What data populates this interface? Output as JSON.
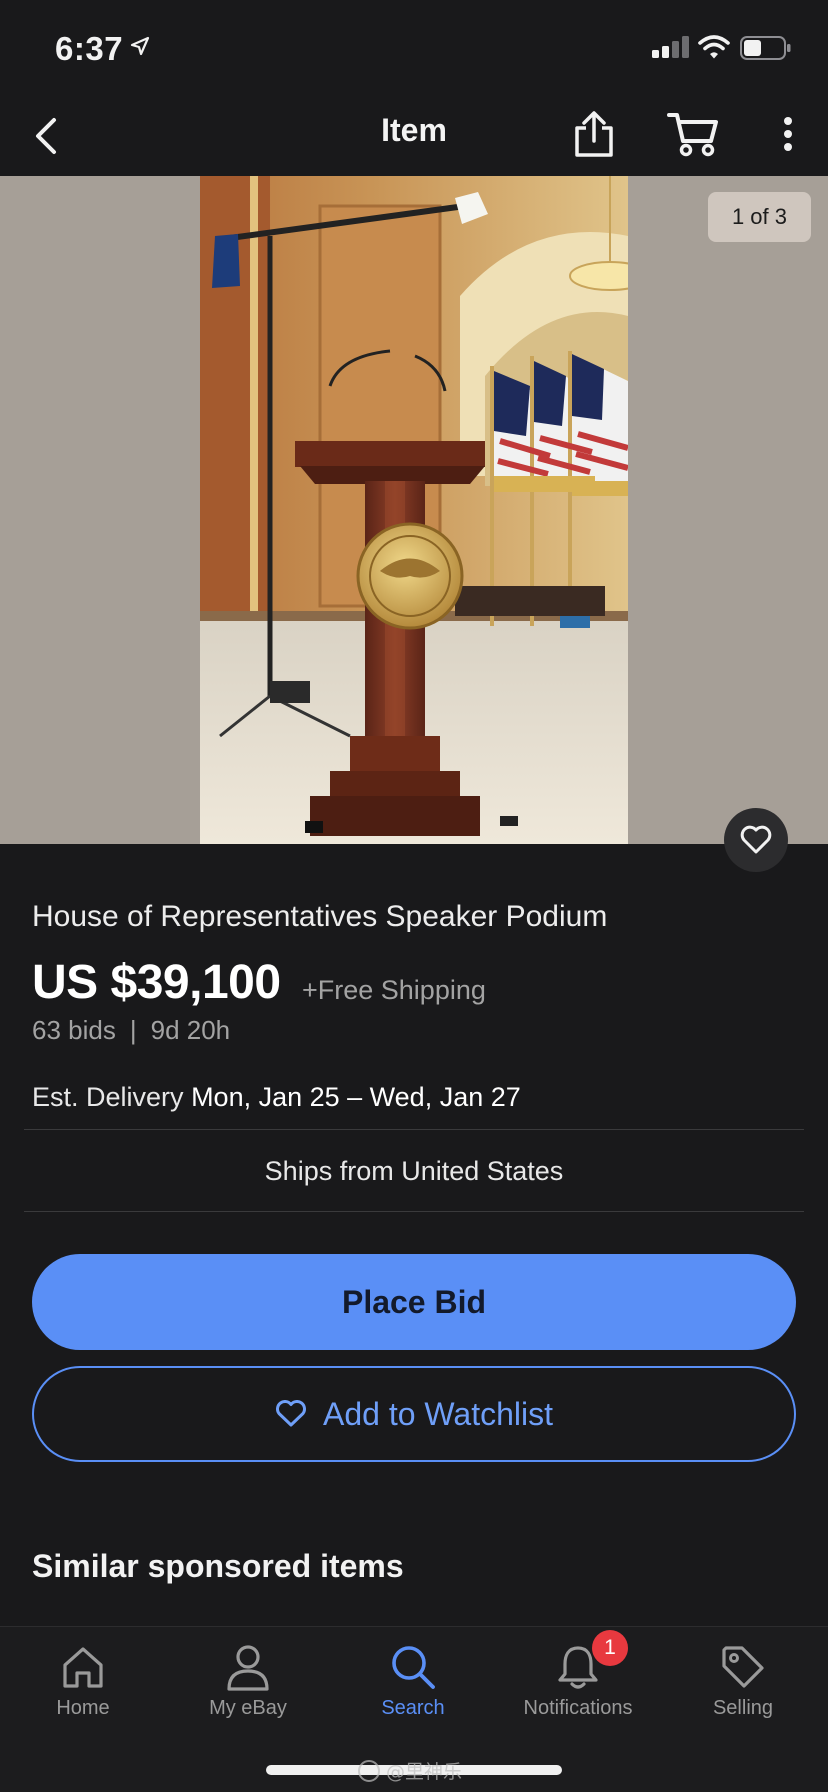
{
  "status": {
    "time": "6:37"
  },
  "nav": {
    "title": "Item"
  },
  "gallery": {
    "counter": "1 of 3"
  },
  "item": {
    "title": "House of Representatives Speaker Podium",
    "price": "US $39,100",
    "shipping": "+Free Shipping",
    "bids": "63 bids",
    "separator": "|",
    "time_left": "9d 20h",
    "delivery_label": "Est. Delivery",
    "delivery_dates": "Mon, Jan 25 – Wed, Jan 27",
    "ships_from": "Ships from United States"
  },
  "actions": {
    "place_bid": "Place Bid",
    "add_watchlist": "Add to Watchlist"
  },
  "similar": {
    "title": "Similar sponsored items"
  },
  "tabs": [
    {
      "label": "Home",
      "icon": "home-icon"
    },
    {
      "label": "My eBay",
      "icon": "person-icon"
    },
    {
      "label": "Search",
      "icon": "search-icon",
      "active": true
    },
    {
      "label": "Notifications",
      "icon": "bell-icon",
      "badge": "1"
    },
    {
      "label": "Selling",
      "icon": "tag-icon"
    }
  ],
  "colors": {
    "accent": "#5a8ff6",
    "background": "#19191b",
    "badge": "#e8393f"
  },
  "watermark": {
    "text": "@里神乐"
  }
}
